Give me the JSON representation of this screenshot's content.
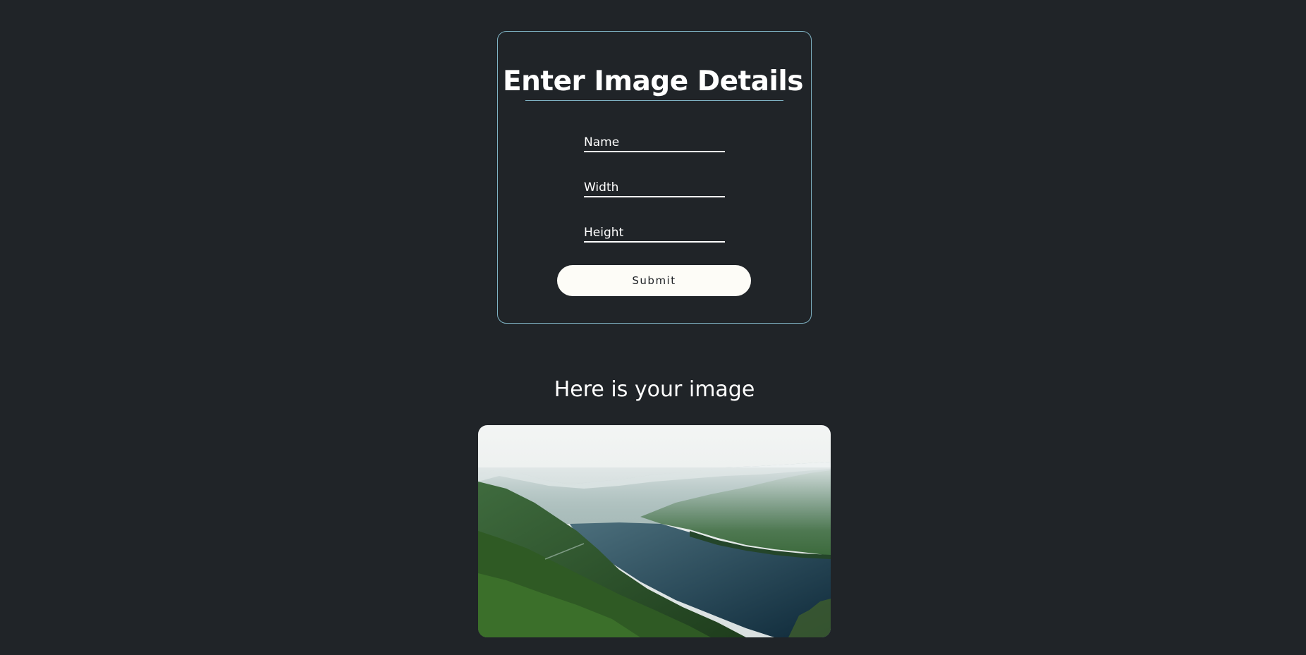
{
  "form": {
    "title": "Enter Image Details",
    "fields": {
      "name": {
        "placeholder": "Name",
        "value": ""
      },
      "width": {
        "placeholder": "Width",
        "value": ""
      },
      "height": {
        "placeholder": "Height",
        "value": ""
      }
    },
    "submit_label": "Submit"
  },
  "result": {
    "heading": "Here is your image",
    "image_subject": "landscape-photo"
  },
  "colors": {
    "background": "#202428",
    "card_border": "#7fb3c4",
    "button_bg": "#fdfcf7",
    "text": "#ffffff"
  }
}
